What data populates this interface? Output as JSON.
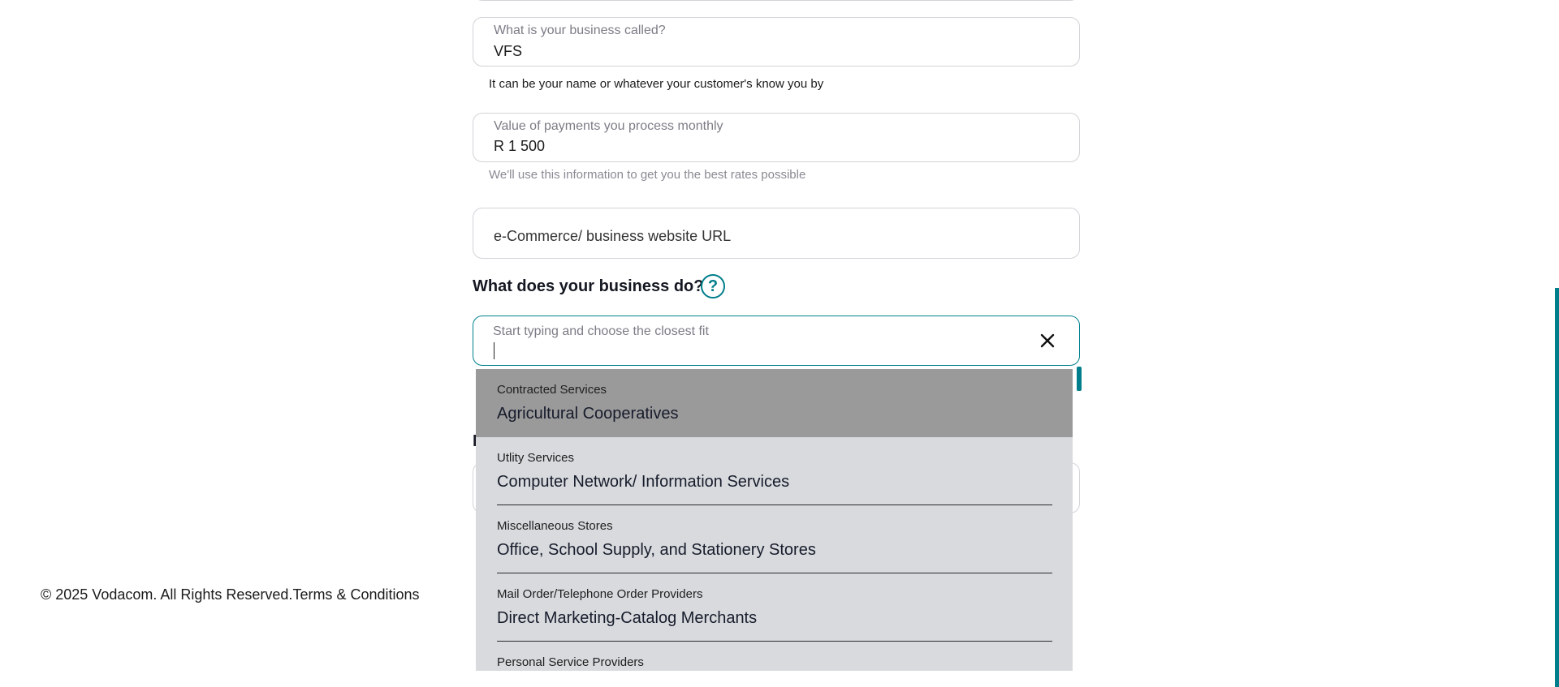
{
  "business_name": {
    "label": "What is your business called?",
    "value": "VFS",
    "helper": "It can be your name or whatever your customer's know you by"
  },
  "monthly_payments": {
    "label": "Value of payments you process monthly",
    "value": "R 1 500",
    "helper": "We'll use this information to get you the best rates possible"
  },
  "website": {
    "placeholder": "e-Commerce/ business website URL"
  },
  "business_activity": {
    "question": "What does your business do?",
    "help_icon": "question-circle-icon",
    "search_label": "Start typing and choose the closest fit",
    "search_value": "",
    "clear_icon": "close-icon",
    "options": [
      {
        "category": "Contracted Services",
        "name": "Agricultural Cooperatives"
      },
      {
        "category": "Utlity Services",
        "name": "Computer Network/ Information Services"
      },
      {
        "category": "Miscellaneous Stores",
        "name": "Office, School Supply, and Stationery Stores"
      },
      {
        "category": "Mail Order/Telephone Order Providers",
        "name": "Direct Marketing-Catalog Merchants"
      },
      {
        "category": "Personal Service Providers",
        "name": ""
      }
    ]
  },
  "footer": {
    "copyright": "© 2025 Vodacom. All Rights Reserved.",
    "terms_link": "Terms & Conditions"
  },
  "colors": {
    "accent": "#007e8b",
    "highlight_option": "#9a9a9a",
    "dropdown_bg": "#d8dadd"
  }
}
